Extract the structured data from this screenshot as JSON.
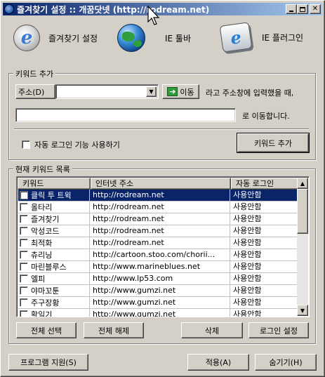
{
  "window": {
    "title": "즐겨찾기 설정 :: 개꿈닷넷 (http://rodream.net)"
  },
  "toolbar": {
    "tiles": [
      {
        "label": "즐겨찾기 설정",
        "icon": "ie-logo-icon"
      },
      {
        "label": "IE 툴바",
        "icon": "globe-icon"
      },
      {
        "label": "IE 플러그인",
        "icon": "ie-key-icon"
      }
    ]
  },
  "keyword_add": {
    "group_title": "키워드 추가",
    "address_label": "주소(D)",
    "address_value": "",
    "go_label": "이동",
    "after_address_text": "라고 주소창에 입력했을 때,",
    "target_value": "",
    "after_target_text": "로 이동합니다.",
    "auto_login_label": "자동 로그인 기능 사용하기",
    "auto_login_checked": false,
    "add_button_label": "키워드 추가"
  },
  "keyword_list": {
    "group_title": "현재 키워드 목록",
    "columns": [
      "키워드",
      "인터넷 주소",
      "자동 로그인"
    ],
    "rows": [
      {
        "keyword": "클릭 투 트윅",
        "url": "http://rodream.net",
        "auto_login": "사용안함",
        "selected": true
      },
      {
        "keyword": "올타리",
        "url": "http://rodream.net",
        "auto_login": "사용안함",
        "selected": false
      },
      {
        "keyword": "즐겨찾기",
        "url": "http://rodream.net",
        "auto_login": "사용안함",
        "selected": false
      },
      {
        "keyword": "악성코드",
        "url": "http://rodream.net",
        "auto_login": "사용안함",
        "selected": false
      },
      {
        "keyword": "최적화",
        "url": "http://rodream.net",
        "auto_login": "사용안함",
        "selected": false
      },
      {
        "keyword": "츄리닝",
        "url": "http://cartoon.stoo.com/chorii...",
        "auto_login": "사용안함",
        "selected": false
      },
      {
        "keyword": "마린블루스",
        "url": "http://www.marineblues.net",
        "auto_login": "사용안함",
        "selected": false
      },
      {
        "keyword": "엘피",
        "url": "http://www.lp53.com",
        "auto_login": "사용안함",
        "selected": false
      },
      {
        "keyword": "야마꼬툰",
        "url": "http://www.gumzi.net",
        "auto_login": "사용안함",
        "selected": false
      },
      {
        "keyword": "주구장황",
        "url": "http://www.gumzi.net",
        "auto_login": "사용안함",
        "selected": false
      },
      {
        "keyword": "활일기",
        "url": "http://www.gumzi.net",
        "auto_login": "사용안함",
        "selected": false
      }
    ],
    "select_all_label": "전체 선택",
    "deselect_all_label": "전체 해제",
    "delete_label": "삭제",
    "login_settings_label": "로그인 설정"
  },
  "footer": {
    "support_label": "프로그램 지원(S)",
    "apply_label": "적용(A)",
    "hide_label": "숨기기(H)"
  }
}
